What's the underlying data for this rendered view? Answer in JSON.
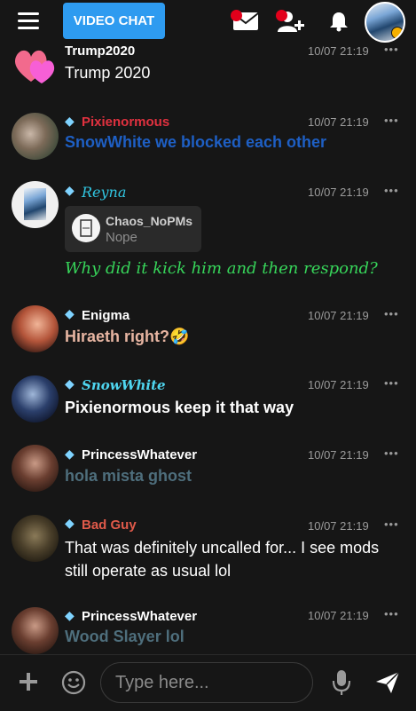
{
  "header": {
    "video_chat_label": "VIDEO CHAT"
  },
  "composer": {
    "placeholder": "Type here..."
  },
  "messages": [
    {
      "username": "Trump2020",
      "text": "Trump 2020",
      "time": "10/07 21:19",
      "more": "•••"
    },
    {
      "username": "Pixienormous",
      "text": "SnowWhite we blocked each other",
      "time": "10/07 21:19",
      "more": "•••"
    },
    {
      "username": "Reyna",
      "reply_user": "Chaos_NoPMs",
      "reply_text": "Nope",
      "text": "Why did it kick him and then respond?",
      "time": "10/07 21:19",
      "more": "•••"
    },
    {
      "username": "Enigma",
      "text": "Hiraeth right?🤣",
      "time": "10/07 21:19",
      "more": "•••"
    },
    {
      "username": "SnowWhite",
      "text": "Pixienormous keep it that way",
      "time": "10/07 21:19",
      "more": "•••"
    },
    {
      "username": "PrincessWhatever",
      "text": "hola mista ghost",
      "time": "10/07 21:19",
      "more": "•••"
    },
    {
      "username": "Bad Guy",
      "text": "That was definitely uncalled for... I see mods still operate as usual lol",
      "time": "10/07 21:19",
      "more": "•••"
    },
    {
      "username": "PrincessWhatever",
      "text": "Wood Slayer lol",
      "time": "10/07 21:19",
      "more": "•••"
    }
  ],
  "colors": {
    "video_chat_button": "#2e9bf0",
    "notification_dot": "#e3001b",
    "pixienormous": "#e0313f",
    "snowwhite_we_blocked": "#1e5fc4",
    "reyna": "#31c5e0",
    "reyna_message": "#37d55a",
    "enigma_message": "#e7b5a2",
    "snowwhite_name": "#4fd6f0",
    "princess_message": "#4e6e7c",
    "bad_guy": "#e05a4a"
  }
}
